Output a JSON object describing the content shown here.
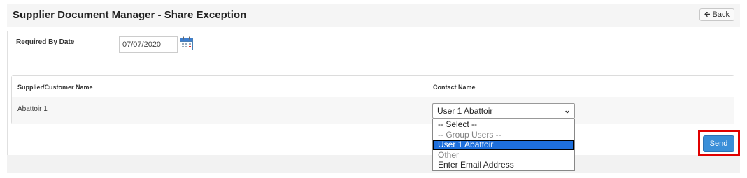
{
  "header": {
    "title": "Supplier Document Manager - Share Exception",
    "back_label": "Back",
    "back_icon": "arrow-left-icon"
  },
  "form": {
    "required_by_label": "Required By Date",
    "required_by_value": "07/07/2020",
    "calendar_icon": "calendar-icon"
  },
  "table": {
    "columns": [
      "Supplier/Customer Name",
      "Contact Name"
    ],
    "rows": [
      {
        "supplier": "Abattoir 1",
        "contact": "User 1 Abattoir"
      }
    ]
  },
  "contact_dropdown": {
    "options": [
      {
        "label": "-- Select --",
        "state": "normal"
      },
      {
        "label": "-- Group Users --",
        "state": "disabled"
      },
      {
        "label": "User 1 Abattoir",
        "state": "selected"
      },
      {
        "label": "Other",
        "state": "disabled"
      },
      {
        "label": "Enter Email Address",
        "state": "normal"
      }
    ]
  },
  "actions": {
    "send_label": "Send"
  },
  "colors": {
    "send_button": "#3a8fd8",
    "highlight": "#e00000",
    "selected_option": "#1e6fdc"
  }
}
